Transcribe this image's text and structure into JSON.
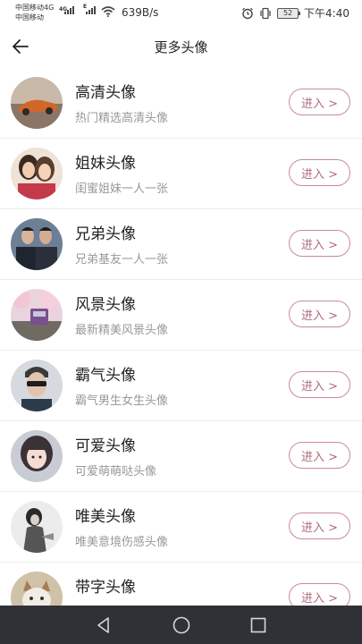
{
  "status_bar": {
    "carrier_1": "中国移动4G",
    "carrier_2": "中国移动",
    "net_badge_1": "4G",
    "net_badge_2": "E",
    "speed": "639B/s",
    "battery": "52",
    "time": "下午4:40"
  },
  "header": {
    "title": "更多头像",
    "back_icon": "arrow-left-icon"
  },
  "items": [
    {
      "name": "高清头像",
      "desc": "热门精选高清头像",
      "button": "进入 >"
    },
    {
      "name": "姐妹头像",
      "desc": "闺蜜姐妹一人一张",
      "button": "进入 >"
    },
    {
      "name": "兄弟头像",
      "desc": "兄弟基友一人一张",
      "button": "进入 >"
    },
    {
      "name": "风景头像",
      "desc": "最新精美风景头像",
      "button": "进入 >"
    },
    {
      "name": "霸气头像",
      "desc": "霸气男生女生头像",
      "button": "进入 >"
    },
    {
      "name": "可爱头像",
      "desc": "可爱萌萌哒头像",
      "button": "进入 >"
    },
    {
      "name": "唯美头像",
      "desc": "唯美意境伤感头像",
      "button": "进入 >"
    },
    {
      "name": "带字头像",
      "desc": "",
      "button": "进入 >"
    }
  ],
  "nav_bar": {
    "back": "triangle-back-icon",
    "home": "circle-home-icon",
    "recents": "square-recents-icon"
  },
  "colors": {
    "accent": "#b06b7b",
    "navbar": "#303137"
  }
}
